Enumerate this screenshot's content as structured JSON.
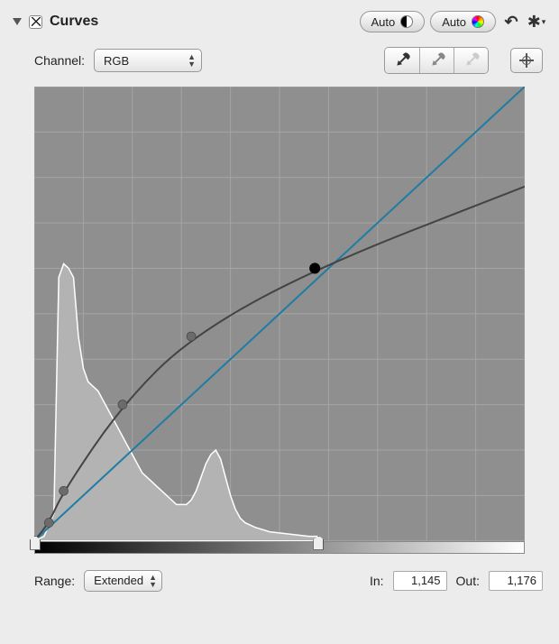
{
  "header": {
    "title": "Curves",
    "enabled": true,
    "auto_bw_label": "Auto",
    "auto_color_label": "Auto"
  },
  "channel": {
    "label": "Channel:",
    "value": "RGB"
  },
  "eyedroppers": {
    "black": "black-point-eyedropper",
    "gray": "gray-point-eyedropper",
    "white": "white-point-eyedropper"
  },
  "range": {
    "label": "Range:",
    "value": "Extended"
  },
  "in": {
    "label": "In:",
    "value": "1,145"
  },
  "out": {
    "label": "Out:",
    "value": "1,176"
  },
  "sliders": {
    "black": 0,
    "white": 58
  },
  "curve": {
    "grid": 10,
    "points_normalized": [
      [
        0.0,
        0.0
      ],
      [
        0.03,
        0.04
      ],
      [
        0.06,
        0.11
      ],
      [
        0.18,
        0.3
      ],
      [
        0.32,
        0.45
      ]
    ],
    "selected_point_normalized": [
      0.572,
      0.6
    ],
    "curve_end_normalized": [
      1.0,
      0.78
    ],
    "histogram_normalized": [
      [
        0.0,
        0.0
      ],
      [
        0.02,
        0.01
      ],
      [
        0.04,
        0.06
      ],
      [
        0.05,
        0.58
      ],
      [
        0.06,
        0.61
      ],
      [
        0.07,
        0.6
      ],
      [
        0.08,
        0.58
      ],
      [
        0.09,
        0.45
      ],
      [
        0.1,
        0.38
      ],
      [
        0.11,
        0.35
      ],
      [
        0.12,
        0.34
      ],
      [
        0.13,
        0.33
      ],
      [
        0.14,
        0.31
      ],
      [
        0.15,
        0.29
      ],
      [
        0.16,
        0.27
      ],
      [
        0.17,
        0.25
      ],
      [
        0.18,
        0.23
      ],
      [
        0.19,
        0.21
      ],
      [
        0.2,
        0.19
      ],
      [
        0.21,
        0.17
      ],
      [
        0.22,
        0.15
      ],
      [
        0.23,
        0.14
      ],
      [
        0.24,
        0.13
      ],
      [
        0.25,
        0.12
      ],
      [
        0.26,
        0.11
      ],
      [
        0.27,
        0.1
      ],
      [
        0.28,
        0.09
      ],
      [
        0.29,
        0.08
      ],
      [
        0.3,
        0.08
      ],
      [
        0.31,
        0.08
      ],
      [
        0.32,
        0.09
      ],
      [
        0.33,
        0.11
      ],
      [
        0.34,
        0.14
      ],
      [
        0.35,
        0.17
      ],
      [
        0.36,
        0.19
      ],
      [
        0.37,
        0.2
      ],
      [
        0.38,
        0.18
      ],
      [
        0.39,
        0.14
      ],
      [
        0.4,
        0.1
      ],
      [
        0.41,
        0.07
      ],
      [
        0.42,
        0.05
      ],
      [
        0.43,
        0.04
      ],
      [
        0.45,
        0.03
      ],
      [
        0.48,
        0.02
      ],
      [
        0.52,
        0.015
      ],
      [
        0.56,
        0.01
      ],
      [
        0.58,
        0.01
      ],
      [
        0.58,
        0.0
      ]
    ]
  }
}
